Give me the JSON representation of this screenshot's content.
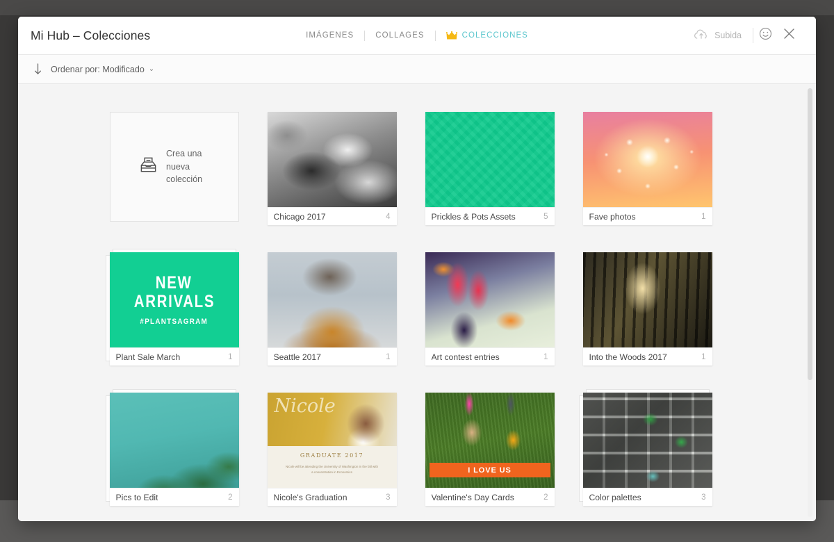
{
  "header": {
    "title": "Mi Hub – Colecciones",
    "tabs": [
      {
        "label": "IMÁGENES",
        "active": false,
        "icon": null
      },
      {
        "label": "COLLAGES",
        "active": false,
        "icon": null
      },
      {
        "label": "COLECCIONES",
        "active": true,
        "icon": "crown-icon"
      }
    ],
    "upload_label": "Subida",
    "upload_icon": "cloud-upload-icon",
    "smiley_icon": "smiley-icon",
    "close_icon": "close-icon",
    "accent_color": "#5bc6cd",
    "crown_color": "#f5b814"
  },
  "sortbar": {
    "direction_icon": "arrow-down-icon",
    "label": "Ordenar por: Modificado",
    "caret_icon": "chevron-down-icon",
    "caret": "⌄"
  },
  "new_collection": {
    "icon": "tray-inbox-icon",
    "line1": "Crea una",
    "line2": "nueva",
    "line3": "colección"
  },
  "thumb_art": {
    "plant_sale": {
      "line1": "NEW",
      "line2": "ARRIVALS",
      "tagline": "#PLANTSAGRAM"
    },
    "graduation": {
      "script": "Nicole",
      "subtitle": "GRADUATE 2017",
      "body": "Nicole will be attending the University of Washington in the fall with a concentration in Economics"
    },
    "valentine": {
      "banner": "I LOVE US"
    }
  },
  "collections": [
    {
      "name": "Chicago 2017",
      "count": "4",
      "art": "th-chicago",
      "stacked": false
    },
    {
      "name": "Prickles & Pots Assets",
      "count": "5",
      "art": "th-prickles",
      "stacked": false
    },
    {
      "name": "Fave photos",
      "count": "1",
      "art": "th-fave",
      "stacked": false
    },
    {
      "name": "Plant Sale March",
      "count": "1",
      "art": "th-plant",
      "stacked": true
    },
    {
      "name": "Seattle 2017",
      "count": "1",
      "art": "th-seattle",
      "stacked": false
    },
    {
      "name": "Art contest entries",
      "count": "1",
      "art": "th-art",
      "stacked": false
    },
    {
      "name": "Into the Woods 2017",
      "count": "1",
      "art": "th-woods",
      "stacked": false
    },
    {
      "name": "Pics to Edit",
      "count": "2",
      "art": "th-palms",
      "stacked": true
    },
    {
      "name": "Nicole's Graduation",
      "count": "3",
      "art": "th-grad",
      "stacked": false
    },
    {
      "name": "Valentine's Day Cards",
      "count": "2",
      "art": "th-valentine",
      "stacked": false
    },
    {
      "name": "Color palettes",
      "count": "3",
      "art": "th-palettes",
      "stacked": true
    }
  ]
}
